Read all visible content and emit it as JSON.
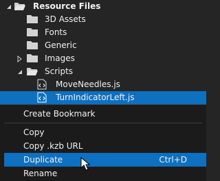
{
  "tree": {
    "items": [
      {
        "label": "Resource Files",
        "expanded": true
      },
      {
        "label": "3D Assets"
      },
      {
        "label": "Fonts"
      },
      {
        "label": "Generic"
      },
      {
        "label": "Images",
        "collapsed": true
      },
      {
        "label": "Scripts",
        "expanded": true
      },
      {
        "label": "MoveNeedles.js"
      },
      {
        "label": "TurnIndicatorLeft.js",
        "selected": true
      }
    ]
  },
  "context_menu": {
    "create_bookmark": "Create Bookmark",
    "copy": "Copy",
    "copy_kzb_url": "Copy .kzb URL",
    "duplicate": "Duplicate",
    "duplicate_shortcut": "Ctrl+D",
    "rename": "Rename"
  },
  "colors": {
    "selection": "#0e70c0",
    "folder": "#d7d7d7",
    "background": "#252526"
  }
}
